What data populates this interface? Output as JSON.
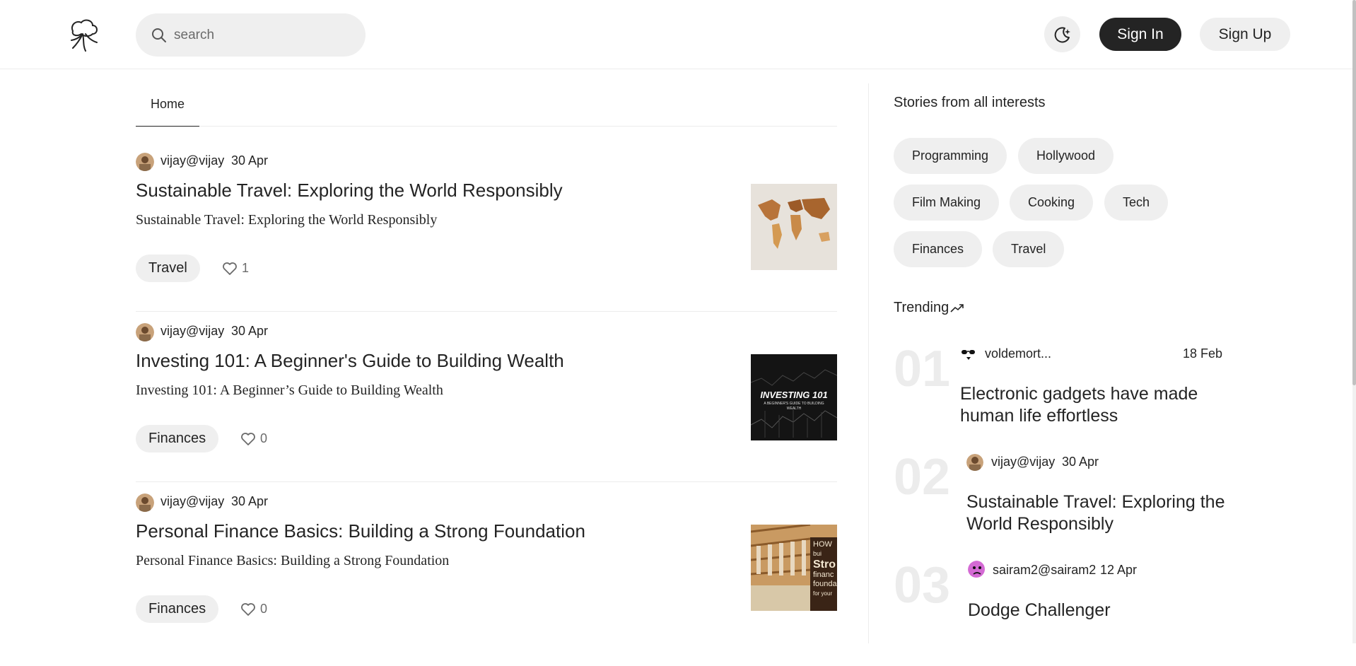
{
  "header": {
    "search_placeholder": "search",
    "signin_label": "Sign In",
    "signup_label": "Sign Up"
  },
  "tabs": [
    {
      "label": "Home",
      "active": true
    }
  ],
  "posts": [
    {
      "author": "vijay@vijay",
      "date": "30 Apr",
      "title": "Sustainable Travel: Exploring the World Responsibly",
      "excerpt": "Sustainable Travel: Exploring the World Responsibly",
      "tag": "Travel",
      "likes": "1",
      "thumb_icon": "world-map-image"
    },
    {
      "author": "vijay@vijay",
      "date": "30 Apr",
      "title": "Investing 101: A Beginner's Guide to Building Wealth",
      "excerpt": "Investing 101: A Beginner’s Guide to Building Wealth",
      "tag": "Finances",
      "likes": "0",
      "thumb_icon": "investing-cover-image",
      "thumb_text_1": "INVESTING 101",
      "thumb_text_2": "A BEGINNER'S GUIDE TO BUILDING WEALTH"
    },
    {
      "author": "vijay@vijay",
      "date": "30 Apr",
      "title": "Personal Finance Basics: Building a Strong Foundation",
      "excerpt": "Personal Finance Basics: Building a Strong Foundation",
      "tag": "Finances",
      "likes": "0",
      "thumb_icon": "finance-foundation-image",
      "thumb_lines": [
        "HOW",
        "bui",
        "Stro",
        "financ",
        "founda",
        "for your"
      ]
    }
  ],
  "sidebar": {
    "title": "Stories from all interests",
    "interests": [
      "Programming",
      "Hollywood",
      "Film Making",
      "Cooking",
      "Tech",
      "Finances",
      "Travel"
    ],
    "trending_label": "Trending",
    "trending": [
      {
        "rank": "01",
        "author": "voldemort...",
        "date": "18 Feb",
        "title": "Electronic gadgets have made human life effortless"
      },
      {
        "rank": "02",
        "author": "vijay@vijay",
        "date": "30 Apr",
        "title": "Sustainable Travel: Exploring the World Responsibly"
      },
      {
        "rank": "03",
        "author": "sairam2@sairam2",
        "date": "12 Apr",
        "title": "Dodge Challenger"
      }
    ]
  },
  "colors": {
    "text": "#242424",
    "chip_bg": "#efefef",
    "signin_bg": "#242424",
    "divider": "#ececec"
  }
}
